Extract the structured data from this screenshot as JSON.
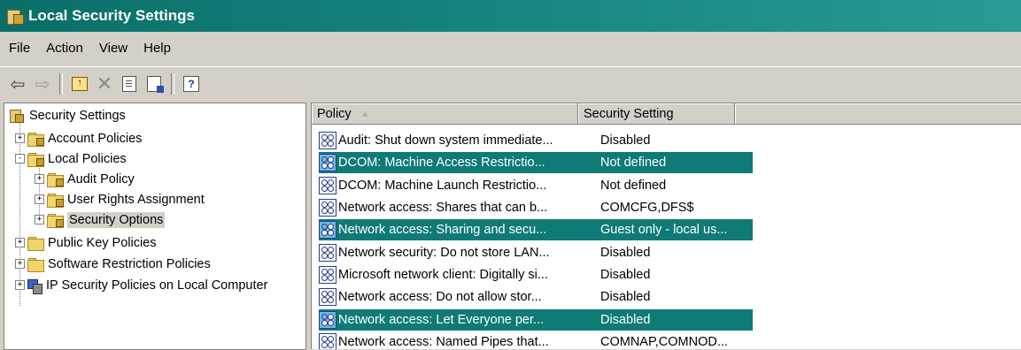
{
  "window": {
    "title": "Local Security Settings"
  },
  "menu": [
    "File",
    "Action",
    "View",
    "Help"
  ],
  "tree": {
    "root": "Security Settings",
    "items": [
      {
        "label": "Account Policies",
        "level": 1,
        "expander": "+"
      },
      {
        "label": "Local Policies",
        "level": 1,
        "expander": "-"
      },
      {
        "label": "Audit Policy",
        "level": 2,
        "expander": "+"
      },
      {
        "label": "User Rights Assignment",
        "level": 2,
        "expander": "+"
      },
      {
        "label": "Security Options",
        "level": 2,
        "expander": "+",
        "selected": true
      },
      {
        "label": "Public Key Policies",
        "level": 1,
        "expander": "+"
      },
      {
        "label": "Software Restriction Policies",
        "level": 1,
        "expander": "+"
      },
      {
        "label": "IP Security Policies on Local Computer",
        "level": 1,
        "expander": "+"
      }
    ]
  },
  "list": {
    "columns": [
      "Policy",
      "Security Setting"
    ],
    "sort_indicator": "▲",
    "rows": [
      {
        "policy": "Audit: Shut down system immediate...",
        "setting": "Disabled",
        "selected": false
      },
      {
        "policy": "DCOM: Machine Access Restrictio...",
        "setting": "Not defined",
        "selected": true
      },
      {
        "policy": "DCOM: Machine Launch Restrictio...",
        "setting": "Not defined",
        "selected": false
      },
      {
        "policy": "Network access: Shares that can b...",
        "setting": "COMCFG,DFS$",
        "selected": false
      },
      {
        "policy": "Network access: Sharing and secu...",
        "setting": "Guest only - local us...",
        "selected": true
      },
      {
        "policy": "Network security: Do not store LAN...",
        "setting": "Disabled",
        "selected": false
      },
      {
        "policy": "Microsoft network client: Digitally si...",
        "setting": "Disabled",
        "selected": false
      },
      {
        "policy": "Network access: Do not allow stor...",
        "setting": "Disabled",
        "selected": false
      },
      {
        "policy": "Network access: Let Everyone per...",
        "setting": "Disabled",
        "selected": true
      },
      {
        "policy": "Network access: Named Pipes that...",
        "setting": "COMNAP,COMNOD...",
        "selected": false
      }
    ]
  },
  "toolbar": {
    "buttons": [
      "back-arrow-icon",
      "forward-arrow-icon",
      "up-folder-icon",
      "delete-icon",
      "properties-icon",
      "export-list-icon",
      "help-icon"
    ]
  },
  "colors": {
    "title_bar": "#1b8a84",
    "selection": "#0f7a76",
    "chrome": "#d4d0c8"
  }
}
